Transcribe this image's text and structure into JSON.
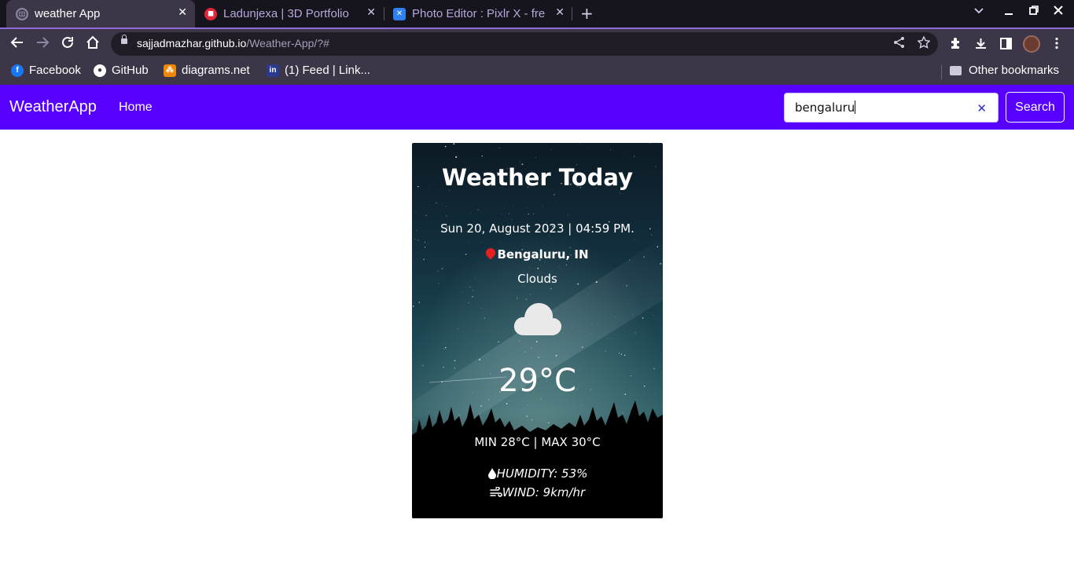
{
  "browser": {
    "tabs": [
      {
        "title": "weather App",
        "active": true
      },
      {
        "title": "Ladunjexa | 3D Portfolio",
        "active": false
      },
      {
        "title": "Photo Editor : Pixlr X - free",
        "active": false
      }
    ],
    "url_host": "sajjadmazhar.github.io",
    "url_path": "/Weather-App/?#",
    "bookmarks": [
      "Facebook",
      "GitHub",
      "diagrams.net",
      "(1) Feed | Link..."
    ],
    "other_bookmarks": "Other bookmarks"
  },
  "app": {
    "brand": "WeatherApp",
    "nav_home": "Home",
    "search_value": "bengaluru",
    "search_button": "Search",
    "accent_color": "#5800ff"
  },
  "weather": {
    "title": "Weather Today",
    "datetime": "Sun 20, August 2023 | 04:59 PM.",
    "location": "Bengaluru, IN",
    "condition": "Clouds",
    "condition_icon": "cloud-icon",
    "temperature": "29°C",
    "minmax": "MIN 28°C | MAX 30°C",
    "humidity": "HUMIDITY: 53%",
    "wind": "WIND: 9km/hr"
  }
}
